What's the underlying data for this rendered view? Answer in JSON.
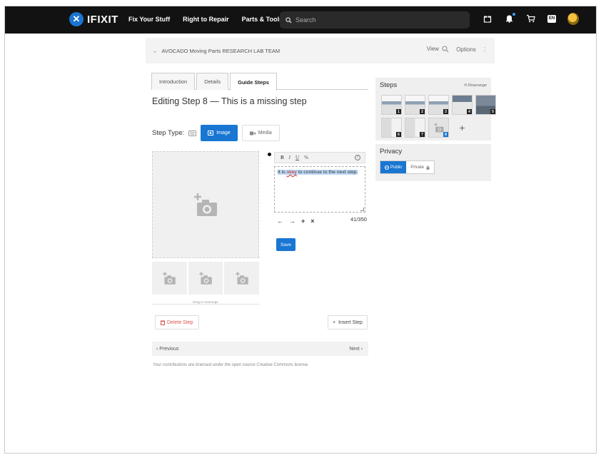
{
  "brand": {
    "logo_text": "IFIXIT",
    "logo_mark": "✕",
    "accent": "#1976d2"
  },
  "nav": {
    "links": [
      "Fix Your Stuff",
      "Right to Repair",
      "Parts & Tools"
    ],
    "search_placeholder": "Search",
    "icons": [
      "gift-box-icon",
      "notification-bell-icon",
      "shopping-cart-icon",
      "language-icon",
      "user-avatar-icon"
    ],
    "language_code": "EN"
  },
  "breadcrumb": {
    "back_arrow": "←",
    "title": "AVOCADO Moving Parts RESEARCH LAB TEAM",
    "view_label": "View",
    "options_label": "Options"
  },
  "tabs": [
    {
      "label": "Introduction",
      "active": false
    },
    {
      "label": "Details",
      "active": false
    },
    {
      "label": "Guide Steps",
      "active": true
    }
  ],
  "editor": {
    "heading": "Editing Step 8 — This is a missing step",
    "step_type_label": "Step Type:",
    "image_button": "Image",
    "media_button": "Media",
    "toolbar": {
      "bold": "B",
      "italic": "I",
      "underline": "U",
      "link": "%",
      "help": "?"
    },
    "text_before": "It is ",
    "text_misspelt": "okey",
    "text_after": " to continue to the next step.",
    "list_buttons": [
      "←",
      "→",
      "+",
      "×"
    ],
    "char_count": "41/350",
    "save_label": "Save",
    "drag_note": "Drag to rearrange"
  },
  "actions": {
    "delete_label": "Delete Step",
    "insert_label": "Insert Step",
    "previous_label": "‹ Previous",
    "next_label": "Next ›",
    "license_text": "Your contributions are licensed under the open source Creative Commons license."
  },
  "steps_panel": {
    "title": "Steps",
    "rearrange_label": "Rearrange",
    "step_numbers": [
      "1",
      "2",
      "3",
      "4",
      "5",
      "6",
      "7",
      "8"
    ],
    "add_label": "+"
  },
  "privacy": {
    "title": "Privacy",
    "public_label": "Public",
    "private_label": "Private"
  }
}
